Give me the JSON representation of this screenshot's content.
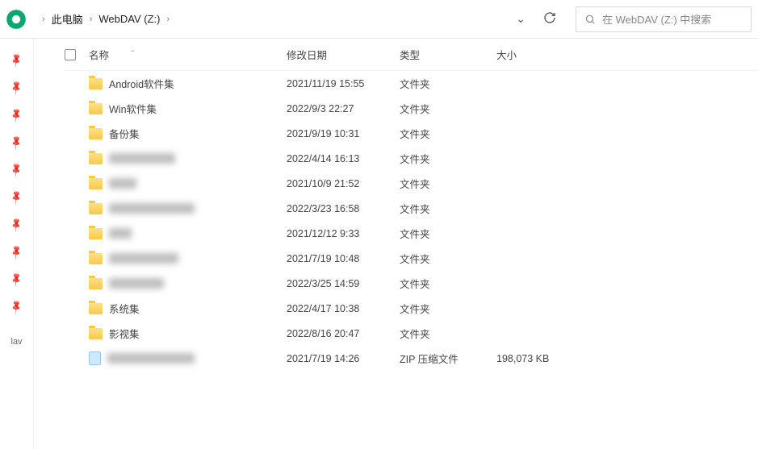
{
  "breadcrumb": {
    "root": "此电脑",
    "drive": "WebDAV (Z:)"
  },
  "search": {
    "placeholder": "在 WebDAV (Z:) 中搜索"
  },
  "quickaccess": {
    "label": "lav"
  },
  "columns": {
    "name": "名称",
    "date": "修改日期",
    "type": "类型",
    "size": "大小"
  },
  "types": {
    "folder": "文件夹",
    "zip": "ZIP 压缩文件"
  },
  "files": [
    {
      "name": "Android软件集",
      "date": "2021/11/19 15:55",
      "type_key": "folder",
      "icon": "folder",
      "blurred": false,
      "size": ""
    },
    {
      "name": "Win软件集",
      "date": "2022/9/3 22:27",
      "type_key": "folder",
      "icon": "folder",
      "blurred": false,
      "size": ""
    },
    {
      "name": "备份集",
      "date": "2021/9/19 10:31",
      "type_key": "folder",
      "icon": "folder",
      "blurred": false,
      "size": ""
    },
    {
      "name": "xxxxxxxxxx",
      "date": "2022/4/14 16:13",
      "type_key": "folder",
      "icon": "folder",
      "blurred": true,
      "blur_width": 82,
      "size": ""
    },
    {
      "name": "xxxx",
      "date": "2021/10/9 21:52",
      "type_key": "folder",
      "icon": "folder",
      "blurred": true,
      "blur_width": 34,
      "size": ""
    },
    {
      "name": "xxxxxxxxxxxxx",
      "date": "2022/3/23 16:58",
      "type_key": "folder",
      "icon": "folder",
      "blurred": true,
      "blur_width": 106,
      "size": ""
    },
    {
      "name": "xxx",
      "date": "2021/12/12 9:33",
      "type_key": "folder",
      "icon": "folder",
      "blurred": true,
      "blur_width": 28,
      "size": ""
    },
    {
      "name": "xxxxxxxxxx",
      "date": "2021/7/19 10:48",
      "type_key": "folder",
      "icon": "folder",
      "blurred": true,
      "blur_width": 86,
      "size": ""
    },
    {
      "name": "xxxxxxxx",
      "date": "2022/3/25 14:59",
      "type_key": "folder",
      "icon": "folder",
      "blurred": true,
      "blur_width": 68,
      "size": ""
    },
    {
      "name": "系统集",
      "date": "2022/4/17 10:38",
      "type_key": "folder",
      "icon": "folder",
      "blurred": false,
      "size": ""
    },
    {
      "name": "影视集",
      "date": "2022/8/16 20:47",
      "type_key": "folder",
      "icon": "folder",
      "blurred": false,
      "size": ""
    },
    {
      "name": "xxxxxxxxxxxxx",
      "date": "2021/7/19 14:26",
      "type_key": "zip",
      "icon": "zip",
      "blurred": true,
      "blur_width": 108,
      "size": "198,073 KB"
    }
  ]
}
